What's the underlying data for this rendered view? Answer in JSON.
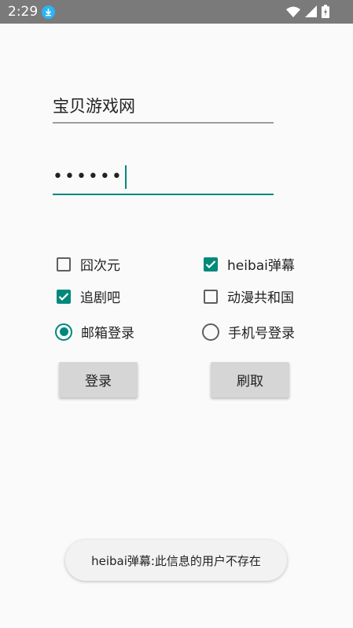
{
  "status_bar": {
    "time": "2:29"
  },
  "login": {
    "username_value": "宝贝游戏网",
    "password_value": "••••••"
  },
  "checkboxes": [
    {
      "label": "囧次元",
      "checked": false
    },
    {
      "label": "heibai弹幕",
      "checked": true
    },
    {
      "label": "追剧吧",
      "checked": true
    },
    {
      "label": "动漫共和国",
      "checked": false
    }
  ],
  "radios": [
    {
      "label": "邮箱登录",
      "checked": true
    },
    {
      "label": "手机号登录",
      "checked": false
    }
  ],
  "buttons": {
    "login": "登录",
    "refresh": "刷取"
  },
  "toast": {
    "message": "heibai弹幕:此信息的用户不存在"
  },
  "colors": {
    "accent": "#00897b",
    "status_bar": "#7a7a7a",
    "button": "#d6d6d6"
  }
}
